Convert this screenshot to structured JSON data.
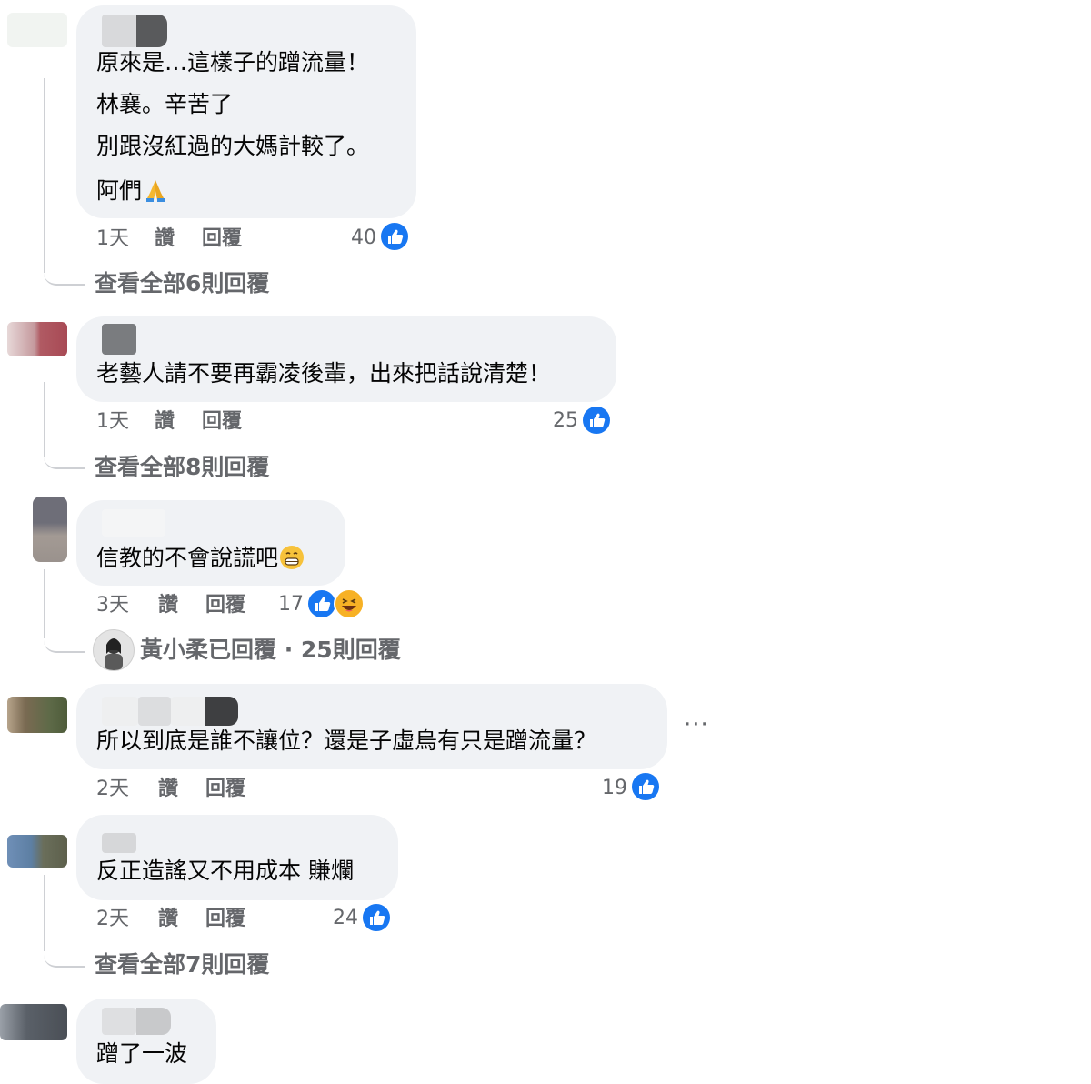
{
  "comments": [
    {
      "lines": [
        "原來是…這樣子的蹭流量！",
        "林襄。辛苦了",
        "別跟沒紅過的大媽計較了。",
        "阿們"
      ],
      "emoji_name": "pray-emoji",
      "time": "1天",
      "like_label": "讚",
      "reply_label": "回覆",
      "reactions": "40",
      "view_replies": "查看全部6則回覆"
    },
    {
      "lines": [
        "老藝人請不要再霸凌後輩，出來把話說清楚！"
      ],
      "time": "1天",
      "like_label": "讚",
      "reply_label": "回覆",
      "reactions": "25",
      "view_replies": "查看全部8則回覆"
    },
    {
      "lines": [
        "信教的不會說謊吧"
      ],
      "emoji_name": "grin-emoji",
      "time": "3天",
      "like_label": "讚",
      "reply_label": "回覆",
      "reactions": "17",
      "reply_summary": "黃小柔已回覆 · 25則回覆"
    },
    {
      "lines": [
        "所以到底是誰不讓位？還是子虛烏有只是蹭流量？"
      ],
      "time": "2天",
      "like_label": "讚",
      "reply_label": "回覆",
      "reactions": "19",
      "menu": "···"
    },
    {
      "lines": [
        "反正造謠又不用成本 賺爛"
      ],
      "time": "2天",
      "like_label": "讚",
      "reply_label": "回覆",
      "reactions": "24",
      "view_replies": "查看全部7則回覆"
    },
    {
      "lines": [
        "蹭了一波"
      ]
    }
  ],
  "colors": {
    "bubble": "#f0f2f5",
    "meta": "#65676b",
    "like_blue": "#1877f2",
    "thread_line": "#ced0d4"
  }
}
